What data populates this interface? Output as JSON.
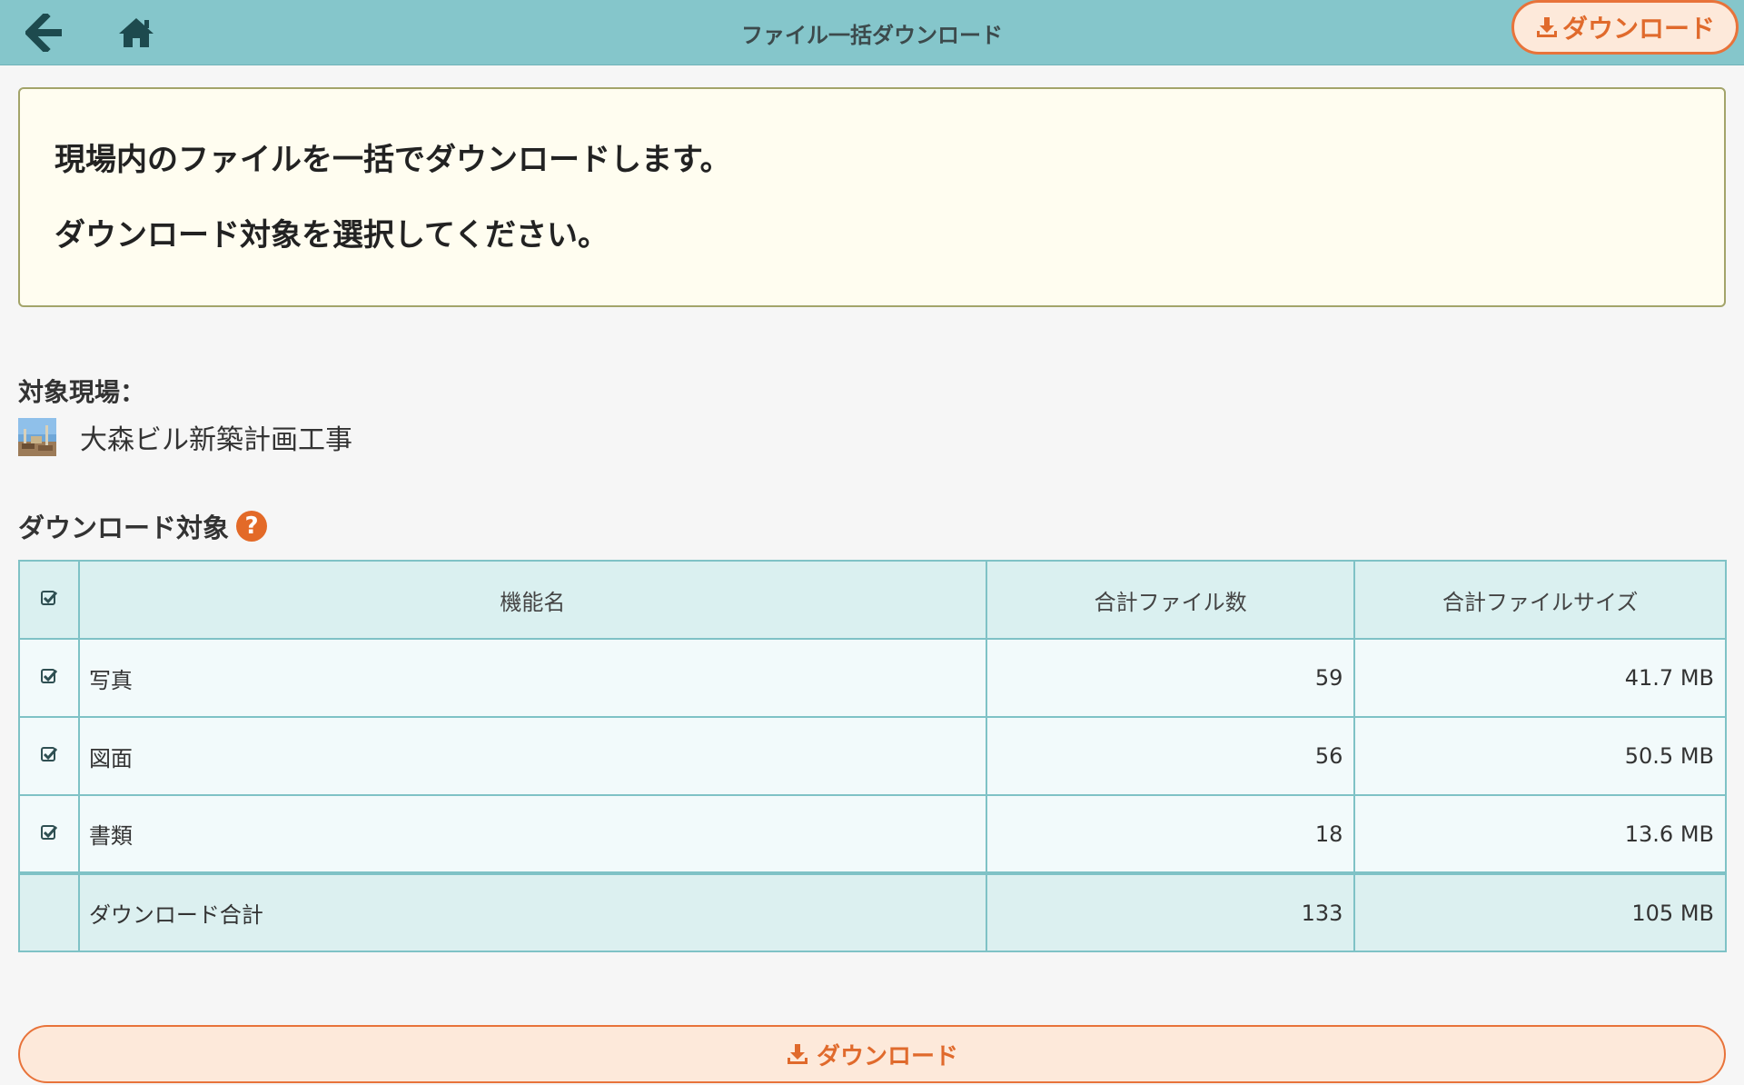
{
  "header": {
    "title": "ファイル一括ダウンロード",
    "download_label": "ダウンロード",
    "back_icon": "arrow-left-icon",
    "home_icon": "home-icon"
  },
  "info": {
    "line1": "現場内のファイルを一括でダウンロードします。",
    "line2": "ダウンロード対象を選択してください。"
  },
  "site": {
    "label": "対象現場：",
    "name": "大森ビル新築計画工事"
  },
  "download_target": {
    "label": "ダウンロード対象",
    "help": "?"
  },
  "table": {
    "headers": {
      "name": "機能名",
      "count": "合計ファイル数",
      "size": "合計ファイルサイズ"
    },
    "rows": [
      {
        "name": "写真",
        "count": "59",
        "size": "41.7 MB",
        "checked": true
      },
      {
        "name": "図面",
        "count": "56",
        "size": "50.5 MB",
        "checked": true
      },
      {
        "name": "書類",
        "count": "18",
        "size": "13.6 MB",
        "checked": true
      }
    ],
    "total": {
      "label": "ダウンロード合計",
      "count": "133",
      "size": "105 MB"
    }
  },
  "bottom_button": {
    "label": "ダウンロード"
  },
  "colors": {
    "header_bg": "#85c6cb",
    "accent_orange": "#e8733a",
    "table_border": "#7fc2c6",
    "info_bg": "#fffdf0"
  }
}
